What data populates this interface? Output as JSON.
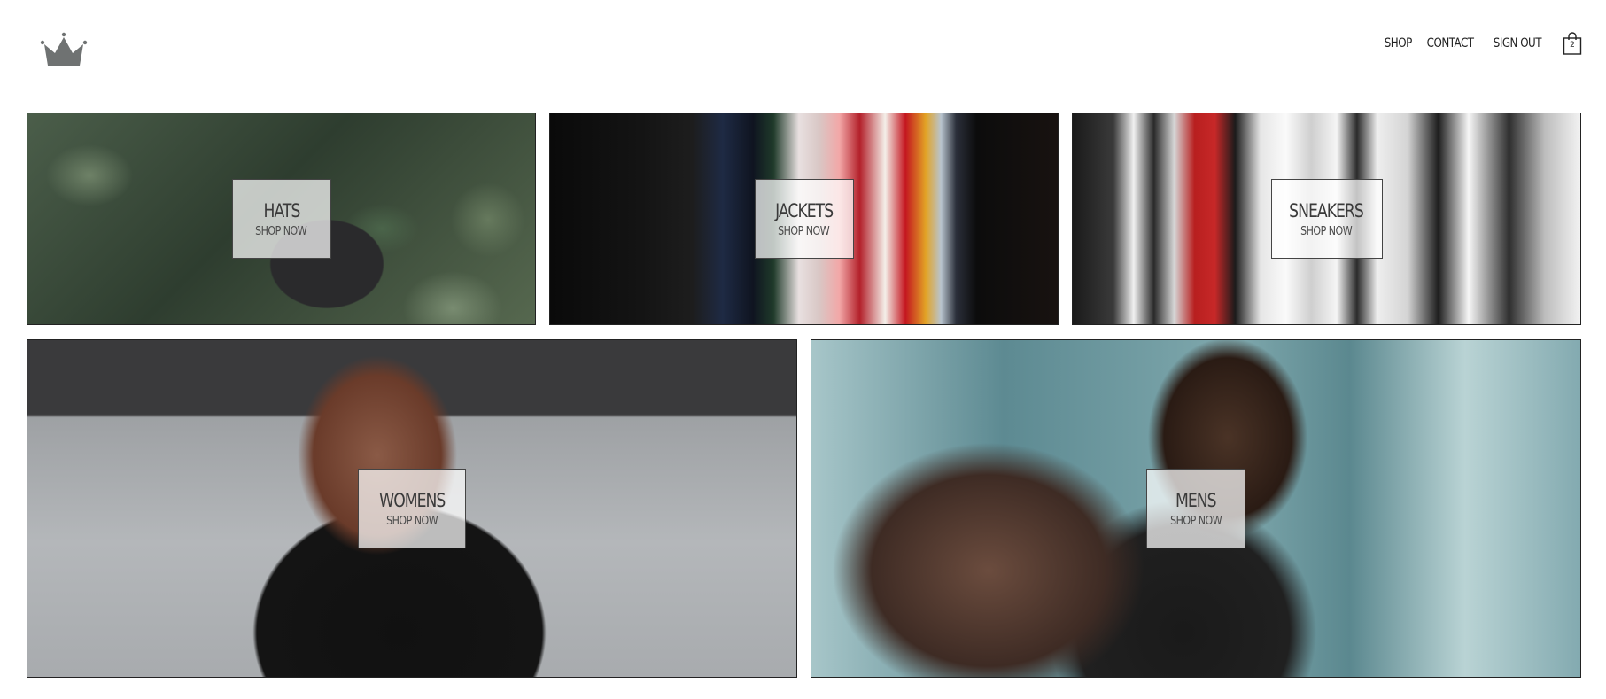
{
  "header": {
    "logo_icon": "crown-icon",
    "nav": {
      "shop": "SHOP",
      "contact": "CONTACT",
      "sign_out": "SIGN OUT"
    },
    "cart": {
      "icon": "shopping-bag-icon",
      "count": "2"
    }
  },
  "directory": [
    {
      "title": "HATS",
      "subtitle": "SHOP NOW"
    },
    {
      "title": "JACKETS",
      "subtitle": "SHOP NOW"
    },
    {
      "title": "SNEAKERS",
      "subtitle": "SHOP NOW"
    },
    {
      "title": "WOMENS",
      "subtitle": "SHOP NOW"
    },
    {
      "title": "MENS",
      "subtitle": "SHOP NOW"
    }
  ]
}
